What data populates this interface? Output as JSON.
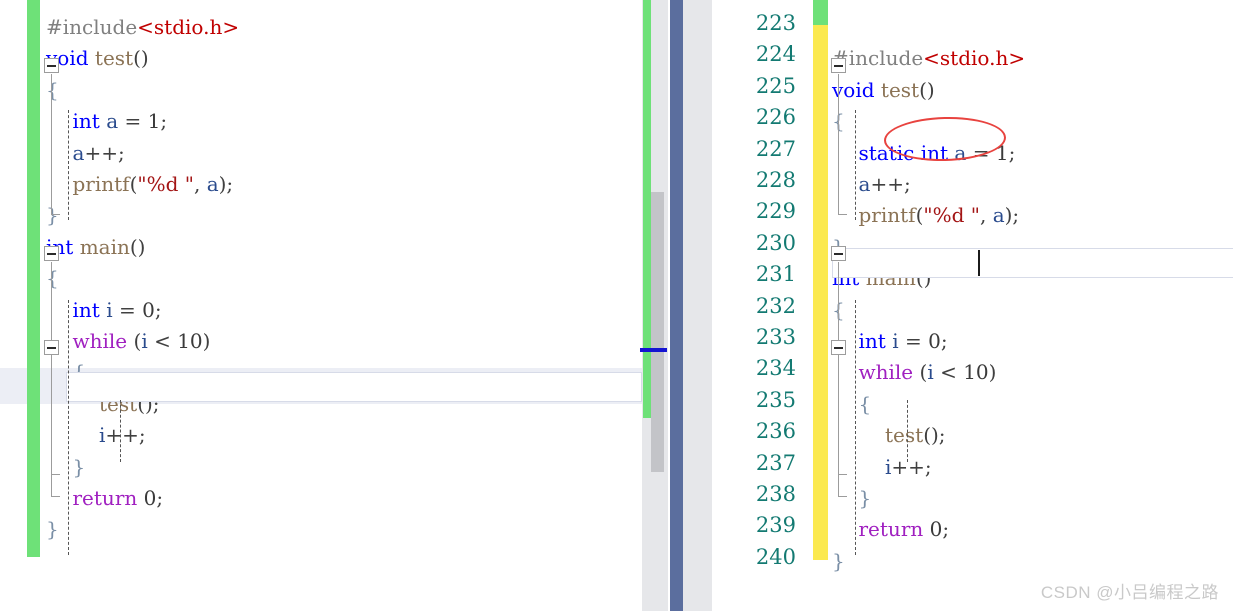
{
  "app": {
    "type": "code-editor-diff-view",
    "watermark": "CSDN @小吕编程之路"
  },
  "colors": {
    "change_bar_added": "#6ee178",
    "change_bar_modified": "#fbe94f",
    "keyword": "#0000ff",
    "control_keyword": "#a020c0",
    "identifier": "#8b7355",
    "include_path": "#c00000",
    "string": "#a31515",
    "line_number": "#137a72",
    "splitter": "#5b6e9e",
    "annotation_ellipse": "#e8433f",
    "scrollbar_thumb": "#c3c4c8",
    "scroll_marker": "#1414d2"
  },
  "left_pane": {
    "name": "left-editor",
    "has_line_numbers": false,
    "change_bar_color": "#6ee178",
    "lines": [
      {
        "indent": 0,
        "tokens": [
          {
            "t": "#include",
            "c": "pp"
          },
          {
            "t": "<stdio.h>",
            "c": "inc"
          }
        ]
      },
      {
        "indent": 0,
        "fold": "open",
        "tokens": [
          {
            "t": "void",
            "c": "kw"
          },
          {
            "t": " ",
            "c": "pl"
          },
          {
            "t": "test",
            "c": "fn"
          },
          {
            "t": "()",
            "c": "pl"
          }
        ]
      },
      {
        "indent": 0,
        "tokens": [
          {
            "t": "{",
            "c": "brc"
          }
        ]
      },
      {
        "indent": 1,
        "tokens": [
          {
            "t": "int",
            "c": "kw"
          },
          {
            "t": " ",
            "c": "pl"
          },
          {
            "t": "a",
            "c": "var"
          },
          {
            "t": " = ",
            "c": "pl"
          },
          {
            "t": "1",
            "c": "num"
          },
          {
            "t": ";",
            "c": "pl"
          }
        ]
      },
      {
        "indent": 1,
        "tokens": [
          {
            "t": "a",
            "c": "var"
          },
          {
            "t": "++;",
            "c": "pl"
          }
        ]
      },
      {
        "indent": 1,
        "tokens": [
          {
            "t": "printf",
            "c": "fn"
          },
          {
            "t": "(",
            "c": "pl"
          },
          {
            "t": "\"%d \"",
            "c": "str"
          },
          {
            "t": ", ",
            "c": "pl"
          },
          {
            "t": "a",
            "c": "var"
          },
          {
            "t": ");",
            "c": "pl"
          }
        ]
      },
      {
        "indent": 0,
        "tokens": [
          {
            "t": "}",
            "c": "brc"
          }
        ]
      },
      {
        "indent": 0,
        "fold": "open",
        "tokens": [
          {
            "t": "int",
            "c": "kw"
          },
          {
            "t": " ",
            "c": "pl"
          },
          {
            "t": "main",
            "c": "fn"
          },
          {
            "t": "()",
            "c": "pl"
          }
        ]
      },
      {
        "indent": 0,
        "tokens": [
          {
            "t": "{",
            "c": "brc"
          }
        ]
      },
      {
        "indent": 1,
        "tokens": [
          {
            "t": "int",
            "c": "kw"
          },
          {
            "t": " ",
            "c": "pl"
          },
          {
            "t": "i",
            "c": "var"
          },
          {
            "t": " = ",
            "c": "pl"
          },
          {
            "t": "0",
            "c": "num"
          },
          {
            "t": ";",
            "c": "pl"
          }
        ]
      },
      {
        "indent": 1,
        "fold": "open",
        "tokens": [
          {
            "t": "while",
            "c": "kw2"
          },
          {
            "t": " (",
            "c": "pl"
          },
          {
            "t": "i",
            "c": "var"
          },
          {
            "t": " < ",
            "c": "pl"
          },
          {
            "t": "10",
            "c": "num"
          },
          {
            "t": ")",
            "c": "pl"
          }
        ]
      },
      {
        "indent": 1,
        "current": true,
        "tokens": [
          {
            "t": "{",
            "c": "brc"
          }
        ]
      },
      {
        "indent": 2,
        "tokens": [
          {
            "t": "test",
            "c": "fn"
          },
          {
            "t": "();",
            "c": "pl"
          }
        ]
      },
      {
        "indent": 2,
        "tokens": [
          {
            "t": "i",
            "c": "var"
          },
          {
            "t": "++;",
            "c": "pl"
          }
        ]
      },
      {
        "indent": 1,
        "tokens": [
          {
            "t": "}",
            "c": "brc"
          }
        ]
      },
      {
        "indent": 1,
        "tokens": [
          {
            "t": "return",
            "c": "kw2"
          },
          {
            "t": " ",
            "c": "pl"
          },
          {
            "t": "0",
            "c": "num"
          },
          {
            "t": ";",
            "c": "pl"
          }
        ]
      },
      {
        "indent": 0,
        "tokens": [
          {
            "t": "}",
            "c": "brc"
          }
        ]
      }
    ]
  },
  "right_pane": {
    "name": "right-editor",
    "has_line_numbers": true,
    "line_numbers": [
      "223",
      "224",
      "225",
      "226",
      "227",
      "228",
      "229",
      "230",
      "231",
      "232",
      "233",
      "234",
      "235",
      "236",
      "237",
      "238",
      "239",
      "240"
    ],
    "change_bar_top_color": "#6ee178",
    "change_bar_color": "#fbe94f",
    "cursor_line": "231",
    "annotation": {
      "label": "static",
      "shape": "ellipse",
      "color": "#e8433f"
    },
    "lines": [
      {
        "indent": 0,
        "tokens": []
      },
      {
        "indent": 0,
        "tokens": [
          {
            "t": "#include",
            "c": "pp"
          },
          {
            "t": "<stdio.h>",
            "c": "inc"
          }
        ]
      },
      {
        "indent": 0,
        "fold": "open",
        "tokens": [
          {
            "t": "void",
            "c": "kw"
          },
          {
            "t": " ",
            "c": "pl"
          },
          {
            "t": "test",
            "c": "fn"
          },
          {
            "t": "()",
            "c": "pl"
          }
        ]
      },
      {
        "indent": 0,
        "tokens": [
          {
            "t": "{",
            "c": "brc"
          }
        ]
      },
      {
        "indent": 1,
        "tokens": [
          {
            "t": "static",
            "c": "kw"
          },
          {
            "t": " ",
            "c": "pl"
          },
          {
            "t": "int",
            "c": "kw"
          },
          {
            "t": " ",
            "c": "pl"
          },
          {
            "t": "a",
            "c": "var"
          },
          {
            "t": " = ",
            "c": "pl"
          },
          {
            "t": "1",
            "c": "num"
          },
          {
            "t": ";",
            "c": "pl"
          }
        ]
      },
      {
        "indent": 1,
        "tokens": [
          {
            "t": "a",
            "c": "var"
          },
          {
            "t": "++;",
            "c": "pl"
          }
        ]
      },
      {
        "indent": 1,
        "tokens": [
          {
            "t": "printf",
            "c": "fn"
          },
          {
            "t": "(",
            "c": "pl"
          },
          {
            "t": "\"%d \"",
            "c": "str"
          },
          {
            "t": ", ",
            "c": "pl"
          },
          {
            "t": "a",
            "c": "var"
          },
          {
            "t": ");",
            "c": "pl"
          }
        ]
      },
      {
        "indent": 0,
        "tokens": [
          {
            "t": "}",
            "c": "brc"
          }
        ]
      },
      {
        "indent": 0,
        "fold": "open",
        "current": true,
        "tokens": [
          {
            "t": "int",
            "c": "kw"
          },
          {
            "t": " ",
            "c": "pl"
          },
          {
            "t": "main",
            "c": "fn"
          },
          {
            "t": "()",
            "c": "pl"
          }
        ]
      },
      {
        "indent": 0,
        "tokens": [
          {
            "t": "{",
            "c": "brc"
          }
        ]
      },
      {
        "indent": 1,
        "tokens": [
          {
            "t": "int",
            "c": "kw"
          },
          {
            "t": " ",
            "c": "pl"
          },
          {
            "t": "i",
            "c": "var"
          },
          {
            "t": " = ",
            "c": "pl"
          },
          {
            "t": "0",
            "c": "num"
          },
          {
            "t": ";",
            "c": "pl"
          }
        ]
      },
      {
        "indent": 1,
        "fold": "open",
        "tokens": [
          {
            "t": "while",
            "c": "kw2"
          },
          {
            "t": " (",
            "c": "pl"
          },
          {
            "t": "i",
            "c": "var"
          },
          {
            "t": " < ",
            "c": "pl"
          },
          {
            "t": "10",
            "c": "num"
          },
          {
            "t": ")",
            "c": "pl"
          }
        ]
      },
      {
        "indent": 1,
        "tokens": [
          {
            "t": "{",
            "c": "brc"
          }
        ]
      },
      {
        "indent": 2,
        "tokens": [
          {
            "t": "test",
            "c": "fn"
          },
          {
            "t": "();",
            "c": "pl"
          }
        ]
      },
      {
        "indent": 2,
        "tokens": [
          {
            "t": "i",
            "c": "var"
          },
          {
            "t": "++;",
            "c": "pl"
          }
        ]
      },
      {
        "indent": 1,
        "tokens": [
          {
            "t": "}",
            "c": "brc"
          }
        ]
      },
      {
        "indent": 1,
        "tokens": [
          {
            "t": "return",
            "c": "kw2"
          },
          {
            "t": " ",
            "c": "pl"
          },
          {
            "t": "0",
            "c": "num"
          },
          {
            "t": ";",
            "c": "pl"
          }
        ]
      },
      {
        "indent": 0,
        "tokens": [
          {
            "t": "}",
            "c": "brc"
          }
        ]
      }
    ]
  },
  "scrollbar": {
    "name": "left-editor-vertical-scrollbar",
    "thumb_color": "#c3c4c8",
    "annotation_marker_color": "#1414d2"
  }
}
